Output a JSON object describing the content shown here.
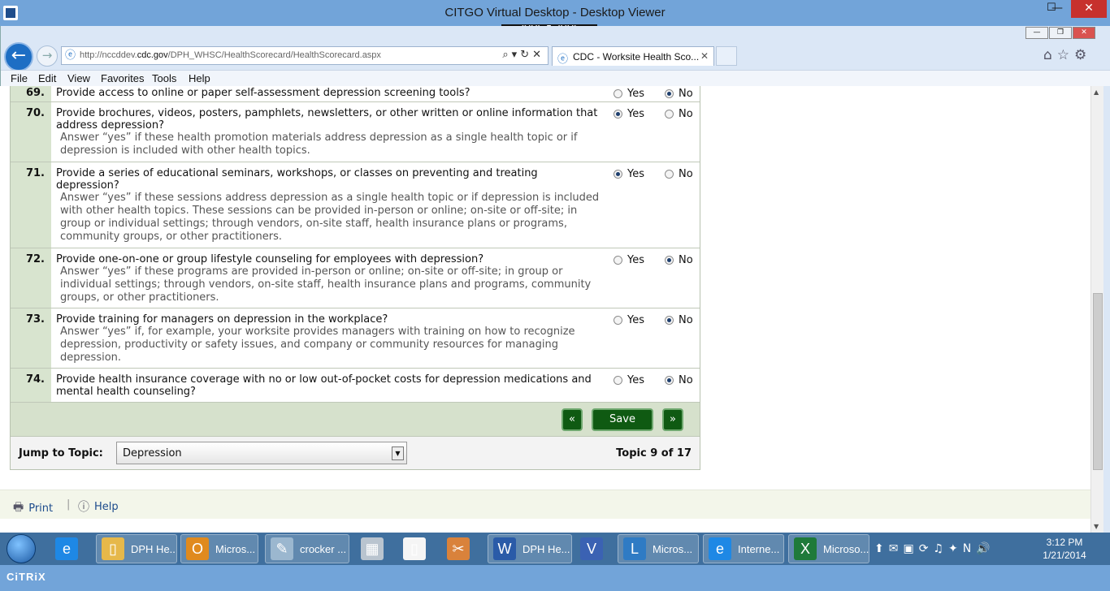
{
  "window": {
    "title": "CITGO Virtual Desktop - Desktop Viewer",
    "min_glyph": "—",
    "max_glyph": "☐",
    "close_glyph": "✕",
    "citrix_toolbar_glyph": "⠿⠿⠿ 🡇 ⠿⠿⠿"
  },
  "browser": {
    "url_prefix": "http://nccddev.",
    "url_domain": "cdc.gov",
    "url_path": "/DPH_WHSC/HealthScorecard/HealthScorecard.aspx",
    "tab_title": "CDC - Worksite Health Sco...",
    "back_glyph": "←",
    "forward_glyph": "→",
    "address_tools": "⌕▾↻✕",
    "tab_close": "✕",
    "right_icons": "⌂☆⚙",
    "window_buttons": [
      "—",
      "❐",
      "✕"
    ],
    "menu": [
      "File",
      "Edit",
      "View",
      "Favorites",
      "Tools",
      "Help"
    ]
  },
  "questions": [
    {
      "number": "69.",
      "text": "Provide access to online or paper self-assessment depression screening tools?",
      "hint": "",
      "answer": "No"
    },
    {
      "number": "70.",
      "text": "Provide brochures, videos, posters, pamphlets, newsletters, or other written or online information that address depression?",
      "hint": "Answer “yes” if these health promotion materials address depression as a single health topic or if depression is included with other health topics.",
      "answer": "Yes"
    },
    {
      "number": "71.",
      "text": "Provide a series of educational seminars, workshops, or classes on preventing and treating depression?",
      "hint": "Answer “yes” if these sessions address depression as a single health topic or if depression is included with other health topics. These sessions can be provided in-person or online; on-site or off-site; in group or individual settings; through vendors, on-site staff, health insurance plans or programs, community groups, or other practitioners.",
      "answer": "Yes"
    },
    {
      "number": "72.",
      "text": "Provide one-on-one or group lifestyle counseling for employees with depression?",
      "hint": "Answer “yes” if these programs are provided in-person or online; on-site or off-site; in group or individual settings; through vendors, on-site staff, health insurance plans and programs, community groups, or other practitioners.",
      "answer": "No"
    },
    {
      "number": "73.",
      "text": "Provide training for managers on depression in the workplace?",
      "hint": "Answer “yes” if, for example, your worksite provides managers with training on how to recognize depression, productivity or safety issues, and company or community resources for managing depression.",
      "answer": "No"
    },
    {
      "number": "74.",
      "text": "Provide health insurance coverage with no or low out-of-pocket costs for depression medications and mental health counseling?",
      "hint": "",
      "answer": "No"
    }
  ],
  "labels": {
    "yes": "Yes",
    "no": "No"
  },
  "nav": {
    "prev": "«",
    "save": "Save",
    "next": "»"
  },
  "topic": {
    "jump_label": "Jump to Topic:",
    "selected": "Depression",
    "count": "Topic 9 of 17",
    "arrow": "▼"
  },
  "footer": {
    "print": "Print",
    "separator": "|",
    "help": "Help"
  },
  "scrollbar": {
    "up": "▲",
    "down": "▼"
  },
  "taskbar": {
    "items": [
      {
        "label": "",
        "icon": "ie-icon",
        "glyph": "e",
        "color": "#1e88e5"
      },
      {
        "label": "DPH He...",
        "icon": "folder-icon",
        "glyph": "▯",
        "color": "#e6b84a"
      },
      {
        "label": "Micros...",
        "icon": "outlook-icon",
        "glyph": "O",
        "color": "#e08a1e"
      },
      {
        "label": "crocker ...",
        "icon": "notepad-icon",
        "glyph": "✎",
        "color": "#9bb7cf"
      },
      {
        "label": "",
        "icon": "calculator-icon",
        "glyph": "▦",
        "color": "#b9c4cf"
      },
      {
        "label": "",
        "icon": "document-icon",
        "glyph": "▯",
        "color": "#f5f5f5"
      },
      {
        "label": "",
        "icon": "snipping-icon",
        "glyph": "✂",
        "color": "#d9823b"
      },
      {
        "label": "DPH He...",
        "icon": "word-icon",
        "glyph": "W",
        "color": "#2a5ba8"
      },
      {
        "label": "",
        "icon": "visio-icon",
        "glyph": "V",
        "color": "#3b62b3"
      },
      {
        "label": "Micros...",
        "icon": "lync-icon",
        "glyph": "L",
        "color": "#2f7bc4"
      },
      {
        "label": "Interne...",
        "icon": "ie-window-icon",
        "glyph": "e",
        "color": "#1e88e5"
      },
      {
        "label": "Microso...",
        "icon": "excel-icon",
        "glyph": "X",
        "color": "#1f7a3a"
      }
    ],
    "tray": "⬆✉▣⟳♫✦N🔊",
    "time": "3:12 PM",
    "date": "1/21/2014"
  },
  "citrix_logo": "CiTRiX"
}
